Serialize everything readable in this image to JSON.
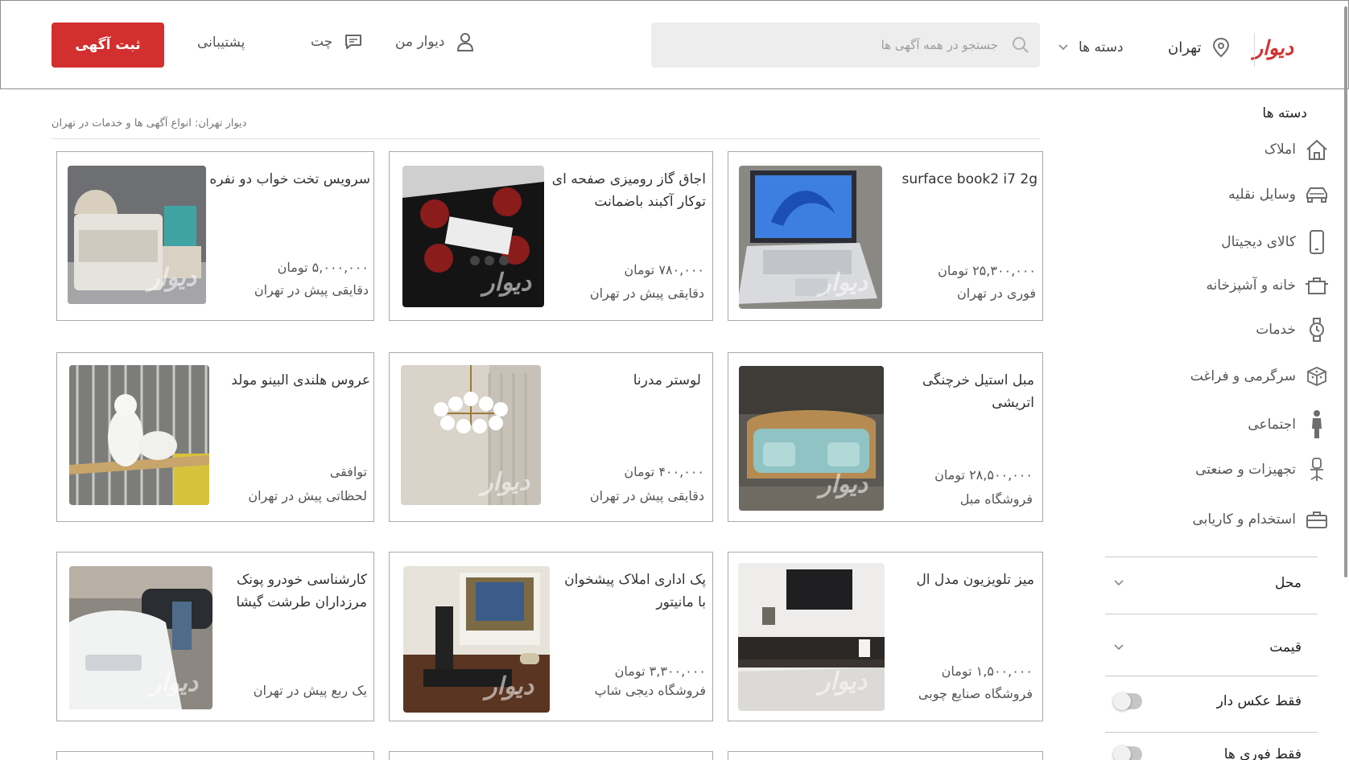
{
  "brand": {
    "logo_text": "دیوار",
    "accent": "#d32f2f"
  },
  "header": {
    "city": "تهران",
    "city_icon": "location-pin-icon",
    "categories_label": "دسته ها",
    "search_placeholder": "جستجو در همه آگهی ها",
    "my_divar": "دیوار من",
    "chat": "چت",
    "support": "پشتیبانی",
    "post_button": "ثبت آگهی"
  },
  "sidebar": {
    "title": "دسته ها",
    "categories": [
      {
        "label": "املاک",
        "icon": "home-icon"
      },
      {
        "label": "وسایل نقلیه",
        "icon": "car-icon"
      },
      {
        "label": "کالای دیجیتال",
        "icon": "phone-icon"
      },
      {
        "label": "خانه و آشپزخانه",
        "icon": "pot-icon"
      },
      {
        "label": "خدمات",
        "icon": "service-icon"
      },
      {
        "label": "سرگرمی و فراغت",
        "icon": "dice-icon"
      },
      {
        "label": "اجتماعی",
        "icon": "person-icon"
      },
      {
        "label": "تجهیزات و صنعتی",
        "icon": "chair-icon"
      },
      {
        "label": "استخدام و کاریابی",
        "icon": "briefcase-icon"
      }
    ],
    "filters": {
      "location": "محل",
      "price": "قیمت",
      "photo_only": "فقط عکس دار",
      "urgent_only": "فقط فوری ها"
    }
  },
  "breadcrumb": "دیوار تهران: انواع آگهی ها و خدمات در تهران",
  "ads": [
    {
      "title": "surface book2 i7 2g",
      "price": "۲۵,۳۰۰,۰۰۰ تومان",
      "meta": "فوری در تهران"
    },
    {
      "title": "اجاق گاز رومیزی صفحه ای توکار آکبند باضمانت",
      "price": "۷۸۰,۰۰۰ تومان",
      "meta": "دقایقی پیش در تهران"
    },
    {
      "title": "سرویس تخت خواب دو نفره",
      "price": "۵,۰۰۰,۰۰۰ تومان",
      "meta": "دقایقی پیش در تهران"
    },
    {
      "title": "مبل استیل خرچنگی اتریشی",
      "price": "۲۸,۵۰۰,۰۰۰ تومان",
      "meta": "فروشگاه مبل"
    },
    {
      "title": "لوستر مدرنا",
      "price": "۴۰۰,۰۰۰ تومان",
      "meta": "دقایقی پیش در تهران"
    },
    {
      "title": "عروس هلندی البینو مولد",
      "price": "توافقی",
      "meta": "لحظاتی پیش در تهران"
    },
    {
      "title": "میز تلویزیون مدل ال",
      "price": "۱,۵۰۰,۰۰۰ تومان",
      "meta": "فروشگاه صنایع چوبی"
    },
    {
      "title": "پک اداری املاک پیشخوان با مانیتور",
      "price": "۳,۳۰۰,۰۰۰ تومان",
      "meta": "فروشگاه دیجی شاپ"
    },
    {
      "title": "کارشناسی خودرو پونک مرزداران طرشت گیشا",
      "price": "",
      "meta": "یک ربع پیش در تهران"
    }
  ],
  "watermark": "دیوار"
}
